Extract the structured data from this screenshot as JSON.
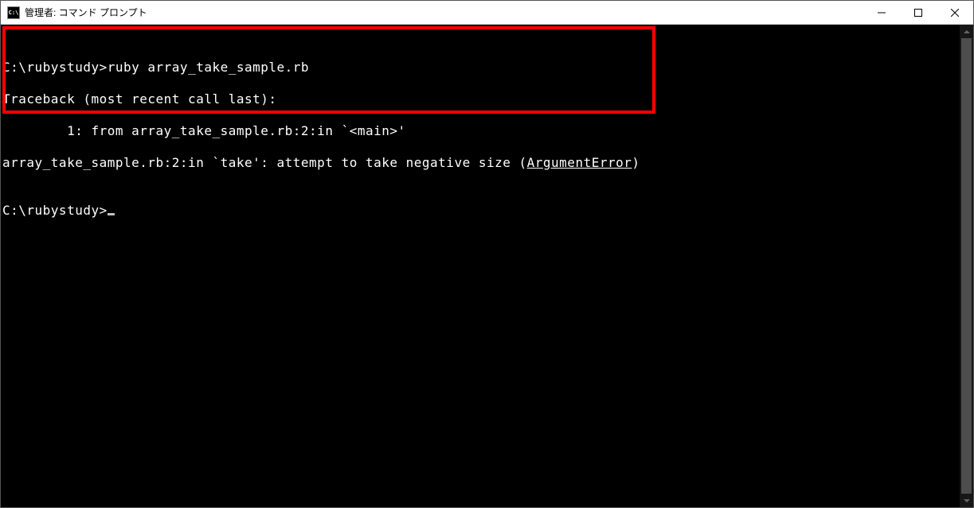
{
  "window": {
    "title": "管理者: コマンド プロンプト",
    "icon_text": "C:\\"
  },
  "console": {
    "lines": {
      "l1_prompt": "C:\\rubystudy>",
      "l1_cmd": "ruby array_take_sample.rb",
      "l2": "Traceback (most recent call last):",
      "l3": "        1: from array_take_sample.rb:2:in `<main>'",
      "l4_a": "array_take_sample.rb:2:in `take': attempt to take negative size (",
      "l4_u": "ArgumentError",
      "l4_b": ")",
      "blank": "",
      "l6": "C:\\rubystudy>"
    }
  }
}
